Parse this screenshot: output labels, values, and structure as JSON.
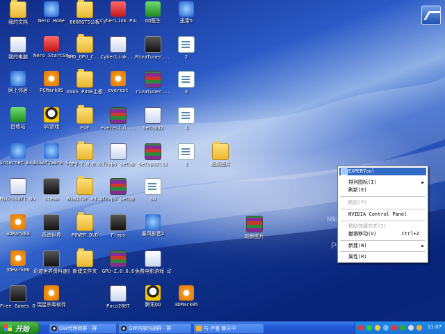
{
  "desktop_icons": [
    {
      "label": "我的文档",
      "icon": "my-documents-icon"
    },
    {
      "label": "Nero Home",
      "icon": "nero-home-icon"
    },
    {
      "label": "8600GTS公板",
      "icon": "folder-icon"
    },
    {
      "label": "CyberLink PowerDVD",
      "icon": "powerdvd-icon"
    },
    {
      "label": "QQ医生",
      "icon": "qq-doctor-icon"
    },
    {
      "label": "迅雷5",
      "icon": "thunder-icon"
    },
    {
      "label": "我的电脑",
      "icon": "my-computer-icon"
    },
    {
      "label": "Nero StartSmart",
      "icon": "nero-startsmart-icon"
    },
    {
      "label": "AMD_GPU_C...",
      "icon": "folder-icon"
    },
    {
      "label": "CyberLink...",
      "icon": "cyberlink-icon"
    },
    {
      "label": "RivaTuner...",
      "icon": "rivatuner-icon"
    },
    {
      "label": "2",
      "icon": "document-icon"
    },
    {
      "label": "网上邻居",
      "icon": "network-icon"
    },
    {
      "label": "PCMark05",
      "icon": "pcmark-icon"
    },
    {
      "label": "ASUS P35E主板 测试数据",
      "icon": "folder-icon"
    },
    {
      "label": "everest",
      "icon": "everest-icon"
    },
    {
      "label": "rivatuner...",
      "icon": "archive-icon"
    },
    {
      "label": "3",
      "icon": "document-icon"
    },
    {
      "label": "回收站",
      "icon": "recycle-bin-icon"
    },
    {
      "label": "QQ游戏",
      "icon": "qq-game-icon"
    },
    {
      "label": "EVE",
      "icon": "folder-icon"
    },
    {
      "label": "everestul...",
      "icon": "archive-icon"
    },
    {
      "label": "Setup32",
      "icon": "setup-icon"
    },
    {
      "label": "4",
      "icon": "document-icon"
    },
    {
      "label": "Internet Explorer",
      "icon": "internet-explorer-icon"
    },
    {
      "label": "SiSoftware Sandra L...",
      "icon": "sisoftware-icon"
    },
    {
      "label": "GPU-Z.0.0.6",
      "icon": "folder-icon"
    },
    {
      "label": "fraps_setup",
      "icon": "fraps-setup-icon"
    },
    {
      "label": "Setup32(1)",
      "icon": "archive-icon"
    },
    {
      "label": "1",
      "icon": "document-icon"
    },
    {
      "label": "超频图片",
      "icon": "folder-icon"
    },
    {
      "label": "Microsoft Outlook",
      "icon": "outlook-icon"
    },
    {
      "label": "Steam",
      "icon": "steam-icon"
    },
    {
      "label": "NiBiTor.v3.4",
      "icon": "folder-icon"
    },
    {
      "label": "fraps_setup",
      "icon": "archive-icon"
    },
    {
      "label": "SN",
      "icon": "document-icon"
    },
    {
      "label": "3DMark03",
      "icon": "3dmark-icon"
    },
    {
      "label": "奇迹世界",
      "icon": "game-icon"
    },
    {
      "label": "POWER DVD",
      "icon": "folder-icon"
    },
    {
      "label": "Fraps",
      "icon": "fraps-icon"
    },
    {
      "label": "暴风影音2",
      "icon": "storm-player-icon"
    },
    {
      "label": "超频图片",
      "icon": "archive-icon"
    },
    {
      "label": "3DMark06",
      "icon": "3dmark-icon"
    },
    {
      "label": "奇迹世界资料速查",
      "icon": "game-icon"
    },
    {
      "label": "新建文件夹",
      "icon": "folder-icon"
    },
    {
      "label": "GPU-Z.0.0.6",
      "icon": "archive-icon"
    },
    {
      "label": "免费电影游戏 动漫下载",
      "icon": "download-icon"
    },
    {
      "label": "Free Games Offer",
      "icon": "games-offer-icon"
    },
    {
      "label": "瑞星杀毒软件",
      "icon": "rising-antivirus-icon"
    },
    {
      "label": "Poco2007",
      "icon": "poco-icon"
    },
    {
      "label": "腾讯QQ",
      "icon": "qq-icon"
    },
    {
      "label": "3DMark05",
      "icon": "3dmark-icon"
    }
  ],
  "watermark": {
    "microsoft": "Micro",
    "windows": "W",
    "product": "Pr"
  },
  "context_menu": {
    "items": [
      {
        "label": "EXPERTool",
        "state": "highlighted",
        "icon": "expertool-icon"
      },
      {
        "label": "排列图标(I)",
        "has_submenu": true
      },
      {
        "label": "刷新(E)"
      },
      {
        "label": "粘贴(P)",
        "state": "disabled"
      },
      {
        "label": "NVIDIA Control Panel"
      },
      {
        "label": "粘贴快捷方式(S)",
        "state": "disabled"
      },
      {
        "label": "撤销移动(U)",
        "shortcut": "Ctrl+Z"
      },
      {
        "label": "新建(W)",
        "has_submenu": true
      },
      {
        "label": "属性(R)"
      }
    ]
  },
  "taskbar": {
    "start_label": "开始",
    "buttons": [
      {
        "label": "GW代理商群 - 群"
      },
      {
        "label": "GW内部沟通群 - 群"
      },
      {
        "label": "与 卢鉴 聊天中"
      }
    ],
    "clock": "11:07"
  }
}
